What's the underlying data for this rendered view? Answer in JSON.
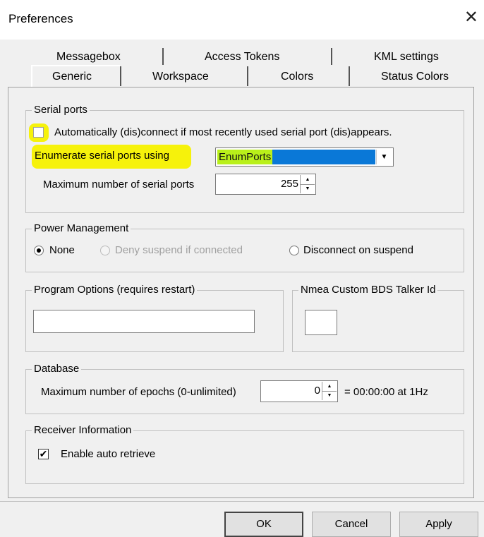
{
  "window": {
    "title": "Preferences",
    "close_glyph": "✕"
  },
  "tabs": {
    "row_back": [
      "Messagebox",
      "Access Tokens",
      "KML settings"
    ],
    "row_front": [
      "Generic",
      "Workspace",
      "Colors",
      "Status Colors"
    ],
    "active": "Generic"
  },
  "serial_ports": {
    "group_label": "Serial ports",
    "auto_connect_checked": false,
    "auto_connect_label": "Automatically (dis)connect if most recently used serial port (dis)appears.",
    "enumerate_label": "Enumerate serial ports using",
    "enumerate_value": "EnumPorts",
    "max_ports_label": "Maximum number of serial ports",
    "max_ports_value": "255"
  },
  "power_management": {
    "group_label": "Power Management",
    "options": [
      "None",
      "Deny suspend if connected",
      "Disconnect on suspend"
    ],
    "selected": "None"
  },
  "program_options": {
    "group_label": "Program Options (requires restart)",
    "value": ""
  },
  "nmea": {
    "group_label": "Nmea Custom BDS Talker Id",
    "value": ""
  },
  "database": {
    "group_label": "Database",
    "max_epochs_label": "Maximum number of epochs (0-unlimited)",
    "max_epochs_value": "0",
    "duration_text": "= 00:00:00 at 1Hz"
  },
  "receiver_info": {
    "group_label": "Receiver Information",
    "auto_retrieve_checked": true,
    "auto_retrieve_label": "Enable auto retrieve"
  },
  "buttons": {
    "ok": "OK",
    "cancel": "Cancel",
    "apply": "Apply"
  },
  "colors": {
    "highlight": "#f6f20b",
    "selection": "#0a78d7",
    "selection_text_bg": "#b9f01a"
  }
}
